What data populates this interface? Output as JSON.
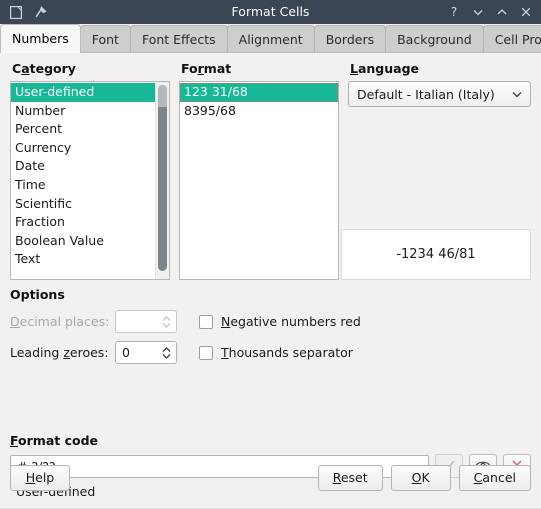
{
  "window": {
    "title": "Format Cells",
    "left_icons": [
      {
        "name": "document-icon",
        "glyph": "❐"
      },
      {
        "name": "pin-icon",
        "glyph": "📌"
      }
    ],
    "right_icons": [
      {
        "name": "help-icon",
        "label": "?"
      },
      {
        "name": "minimize-icon",
        "label": "⌄"
      },
      {
        "name": "maximize-icon",
        "label": "⌃"
      },
      {
        "name": "close-icon",
        "label": "✕"
      }
    ]
  },
  "tabs": [
    {
      "label": "Numbers",
      "active": true
    },
    {
      "label": "Font",
      "active": false
    },
    {
      "label": "Font Effects",
      "active": false
    },
    {
      "label": "Alignment",
      "active": false
    },
    {
      "label": "Borders",
      "active": false
    },
    {
      "label": "Background",
      "active": false
    },
    {
      "label": "Cell Protection",
      "active": false
    }
  ],
  "category": {
    "label": "Category",
    "mnemonic": "a",
    "items": [
      "User-defined",
      "Number",
      "Percent",
      "Currency",
      "Date",
      "Time",
      "Scientific",
      "Fraction",
      "Boolean Value",
      "Text"
    ],
    "selected": "User-defined"
  },
  "format": {
    "label": "Format",
    "mnemonic": "r",
    "items": [
      "123 31/68",
      "8395/68"
    ],
    "selected": "123 31/68"
  },
  "language": {
    "label": "Language",
    "mnemonic": "L",
    "selected": "Default - Italian (Italy)"
  },
  "preview": {
    "text": "-1234 46/81"
  },
  "options": {
    "title": "Options",
    "decimal_places": {
      "label": "Decimal places:",
      "value": "",
      "disabled": true
    },
    "leading_zeroes": {
      "label": "Leading zeroes:",
      "value": "0",
      "disabled": false
    },
    "negative_red": {
      "label": "Negative numbers red",
      "checked": false
    },
    "thousands_separator": {
      "label": "Thousands separator",
      "checked": false
    }
  },
  "format_code": {
    "title": "Format code",
    "value": "# ?/??",
    "placeholder": "",
    "status": "User-defined",
    "buttons": [
      {
        "name": "accept-format-button",
        "icon": "check-icon",
        "disabled": true
      },
      {
        "name": "add-format-button",
        "icon": "eye-icon",
        "disabled": false
      },
      {
        "name": "delete-format-button",
        "icon": "x-icon",
        "disabled": false
      }
    ]
  },
  "footer": {
    "help": "Help",
    "reset": "Reset",
    "ok": "OK",
    "cancel": "Cancel"
  },
  "colors": {
    "titlebar": "#3b4654",
    "selection": "#16b897",
    "dialog_bg": "#f2f1f0",
    "delete_red": "#d9707a"
  }
}
